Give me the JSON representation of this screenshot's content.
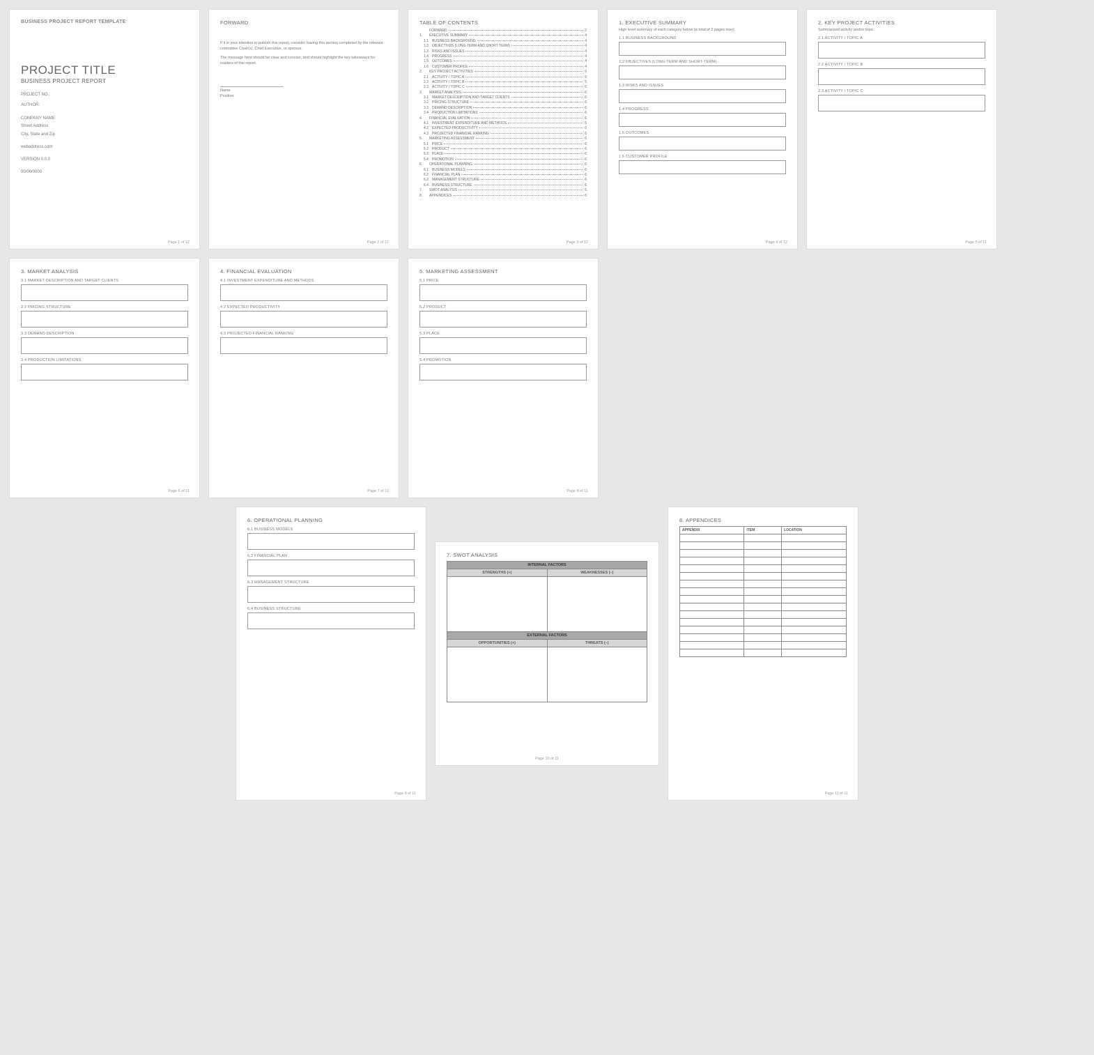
{
  "page1": {
    "template_label": "BUSINESS PROJECT REPORT TEMPLATE",
    "title": "PROJECT TITLE",
    "subtitle": "BUSINESS PROJECT REPORT",
    "project_no": "PROJECT NO.:",
    "author": "AUTHOR:",
    "company": "COMPANY NAME",
    "street": "Street Address",
    "city": "City, State and Zip",
    "web": "webaddress.com",
    "version": "VERSION 0.0.0",
    "date": "00/00/0000",
    "footer": "Page 1 of 12"
  },
  "page2": {
    "heading": "FORWARD",
    "p1": "If it is your intention to publish this report, consider having this section completed by the relevant committee Chair(s), Chief Executive, or sponsor.",
    "p2": "The message here should be clear and concise, and should highlight the key takeaways for readers of this report.",
    "name": "Name",
    "position": "Position",
    "footer": "Page 2 of 12"
  },
  "page3": {
    "heading": "TABLE OF CONTENTS",
    "rows": [
      {
        "n": "",
        "t": "FORWARD",
        "p": "2"
      },
      {
        "n": "1.",
        "t": "EXECUTIVE SUMMARY",
        "p": "4"
      },
      {
        "n": "1.1",
        "t": "BUSINESS BACKGROUND",
        "p": "4",
        "s": 1
      },
      {
        "n": "1.2",
        "t": "OBJECTIVES (LONG-TERM AND SHORT-TERM)",
        "p": "4",
        "s": 1
      },
      {
        "n": "1.3",
        "t": "RISKS AND ISSUES",
        "p": "4",
        "s": 1
      },
      {
        "n": "1.4",
        "t": "PROGRESS",
        "p": "4",
        "s": 1
      },
      {
        "n": "1.5",
        "t": "OUTCOMES",
        "p": "4",
        "s": 1
      },
      {
        "n": "1.6",
        "t": "CUSTOMER PROFILE",
        "p": "4",
        "s": 1
      },
      {
        "n": "2.",
        "t": "KEY PROJECT ACTIVITIES",
        "p": "5"
      },
      {
        "n": "2.1",
        "t": "ACTIVITY / TOPIC A",
        "p": "5",
        "s": 1
      },
      {
        "n": "2.2",
        "t": "ACTIVITY / TOPIC B",
        "p": "5",
        "s": 1
      },
      {
        "n": "2.3",
        "t": "ACTIVITY / TOPIC C",
        "p": "5",
        "s": 1
      },
      {
        "n": "3.",
        "t": "MARKET ANALYSIS",
        "p": "6"
      },
      {
        "n": "3.1",
        "t": "MARKET DESCRIPTION AND TARGET CLIENTS",
        "p": "6",
        "s": 1
      },
      {
        "n": "3.2",
        "t": "PRICING STRUCTURE",
        "p": "6",
        "s": 1
      },
      {
        "n": "3.3",
        "t": "DEMAND DESCRIPTION",
        "p": "6",
        "s": 1
      },
      {
        "n": "3.4",
        "t": "PRODUCTION LIMITATIONS",
        "p": "6",
        "s": 1
      },
      {
        "n": "4.",
        "t": "FINANCIAL EVALUATION",
        "p": "6"
      },
      {
        "n": "4.1",
        "t": "INVESTMENT EXPENDITURE AND METHODS",
        "p": "6",
        "s": 1
      },
      {
        "n": "4.2",
        "t": "EXPECTED PRODUCTIVITY",
        "p": "6",
        "s": 1
      },
      {
        "n": "4.3",
        "t": "PROJECTED FINANCIAL RANKING",
        "p": "6",
        "s": 1
      },
      {
        "n": "5.",
        "t": "MARKETING ASSESSMENT",
        "p": "6"
      },
      {
        "n": "5.1",
        "t": "PRICE",
        "p": "6",
        "s": 1
      },
      {
        "n": "5.2",
        "t": "PRODUCT",
        "p": "6",
        "s": 1
      },
      {
        "n": "5.3",
        "t": "PLACE",
        "p": "6",
        "s": 1
      },
      {
        "n": "5.4",
        "t": "PROMOTION",
        "p": "6",
        "s": 1
      },
      {
        "n": "6.",
        "t": "OPERATIONAL PLANNING",
        "p": "6"
      },
      {
        "n": "6.1",
        "t": "BUSINESS MODELS",
        "p": "6",
        "s": 1
      },
      {
        "n": "6.2",
        "t": "FINANCIAL PLAN",
        "p": "6",
        "s": 1
      },
      {
        "n": "6.3",
        "t": "MANAGEMENT STRUCTURE",
        "p": "6",
        "s": 1
      },
      {
        "n": "6.4",
        "t": "BUSINESS STRUCTURE",
        "p": "6",
        "s": 1
      },
      {
        "n": "7.",
        "t": "SWOT ANALYSIS",
        "p": "6"
      },
      {
        "n": "8.",
        "t": "APPENDICES",
        "p": "6"
      }
    ],
    "footer": "Page 3 of 12"
  },
  "page4": {
    "heading": "1.  EXECUTIVE SUMMARY",
    "note": "High level summary of each category below (a total of 2 pages max)",
    "subs": [
      "1.1   BUSINESS BACKGROUND",
      "1.2   OBJECTIVES (LONG-TERM AND SHORT-TERM)",
      "1.3   RISKS AND ISSUES",
      "1.4   PROGRESS",
      "1.5   OUTCOMES",
      "1.6   CUSTOMER PROFILE"
    ],
    "footer": "Page 4 of 12"
  },
  "page5": {
    "heading": "2.  KEY PROJECT ACTIVITIES",
    "note": "Summarized activity and/or topic",
    "subs": [
      "2.1   ACTIVITY / TOPIC A",
      "2.2   ACTIVITY / TOPIC B",
      "2.3   ACTIVITY / TOPIC C"
    ],
    "footer": "Page 5 of 11"
  },
  "page6": {
    "heading": "3.  MARKET ANALYSIS",
    "subs": [
      "3.1   MARKET DESCRIPTION AND TARGET CLIENTS",
      "3.2   PRICING STRUCTURE",
      "3.3   DEMAND DESCRIPTION",
      "3.4   PRODUCTION LIMITATIONS"
    ],
    "footer": "Page 6 of 11"
  },
  "page7": {
    "heading": "4.  FINANCIAL EVALUATION",
    "subs": [
      "4.1   INVESTMENT EXPENDITURE AND METHODS",
      "4.2   EXPECTED PRODUCTIVITY",
      "4.3   PROJECTED FINANCIAL RANKING"
    ],
    "footer": "Page 7 of 11"
  },
  "page8": {
    "heading": "5.  MARKETING ASSESSMENT",
    "subs": [
      "5.1   PRICE",
      "5.2   PRODUCT",
      "5.3   PLACE",
      "5.4   PROMOTION"
    ],
    "footer": "Page 8 of 11"
  },
  "page9": {
    "heading": "6.  OPERATIONAL PLANNING",
    "subs": [
      "6.1   BUSINESS MODELS",
      "6.2   FINANCIAL PLAN",
      "6.3   MANAGEMENT STRUCTURE",
      "6.4   BUSINESS STRUCTURE"
    ],
    "footer": "Page 9 of 11"
  },
  "page10": {
    "heading": "7.  SWOT ANALYSIS",
    "internal": "INTERNAL FACTORS",
    "external": "EXTERNAL FACTORS",
    "strengths": "STRENGTHS (+)",
    "weaknesses": "WEAKNESSES (–)",
    "opportunities": "OPPORTUNITIES (+)",
    "threats": "THREATS (–)",
    "footer": "Page 10 of 11"
  },
  "page11": {
    "heading": "8.  APPENDICES",
    "cols": [
      "APPENDIX",
      "ITEM",
      "LOCATION"
    ],
    "rows": 16,
    "footer": "Page 11 of 11"
  }
}
